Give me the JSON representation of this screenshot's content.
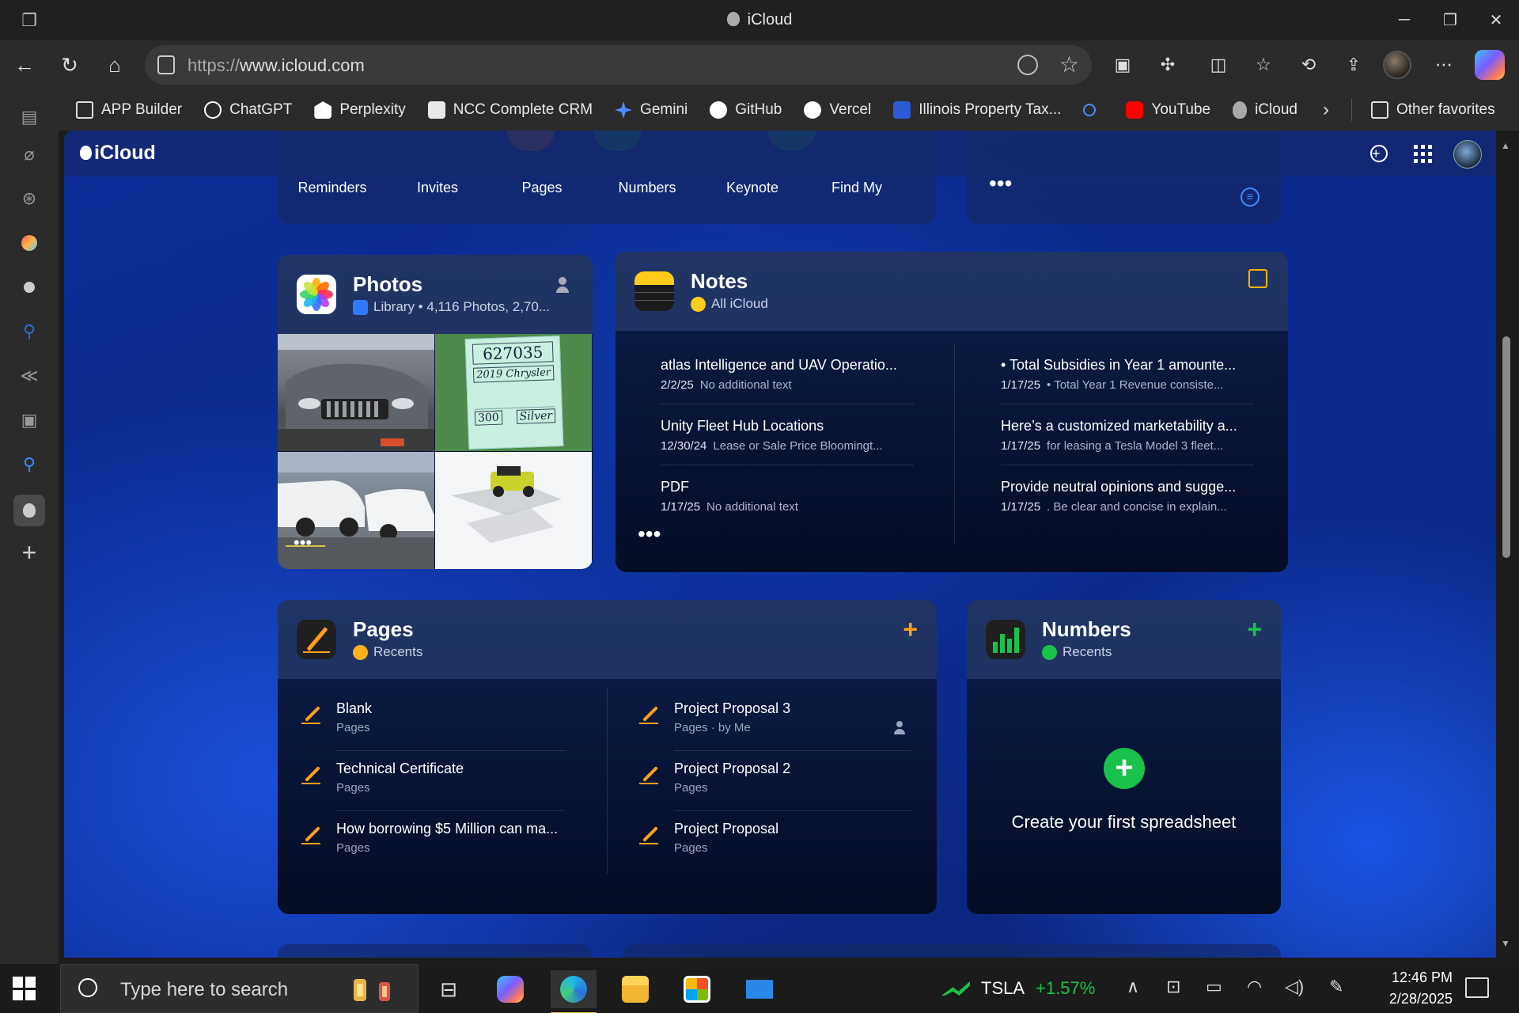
{
  "window": {
    "title": "iCloud"
  },
  "browser": {
    "url_prefix": "https://",
    "url_host": "www.icloud.com",
    "favorites": [
      {
        "label": "APP Builder",
        "icon": "folder-icon"
      },
      {
        "label": "ChatGPT",
        "icon": "chatgpt-icon"
      },
      {
        "label": "Perplexity",
        "icon": "perplexity-icon"
      },
      {
        "label": "NCC Complete CRM",
        "icon": "ncc-icon"
      },
      {
        "label": "Gemini",
        "icon": "gemini-icon"
      },
      {
        "label": "GitHub",
        "icon": "github-icon"
      },
      {
        "label": "Vercel",
        "icon": "vercel-icon"
      },
      {
        "label": "Illinois Property Tax...",
        "icon": "tax-icon"
      },
      {
        "label": "",
        "icon": "search-icon"
      },
      {
        "label": "YouTube",
        "icon": "youtube-icon"
      },
      {
        "label": "iCloud",
        "icon": "apple-icon"
      }
    ],
    "other_favorites": "Other favorites"
  },
  "icloud": {
    "logo": "iCloud",
    "apps": [
      "Reminders",
      "Invites",
      "Pages",
      "Numbers",
      "Keynote",
      "Find My"
    ],
    "photos": {
      "title": "Photos",
      "subtitle": "Library • 4,116 Photos, 2,70...",
      "tag_lines": [
        "627035",
        "2019 Chrysler",
        "300",
        "Silver"
      ]
    },
    "notes": {
      "title": "Notes",
      "subtitle": "All iCloud",
      "items": [
        {
          "title": "atlas Intelligence and UAV Operatio...",
          "date": "2/2/25",
          "preview": "No additional text"
        },
        {
          "title": "Unity Fleet Hub Locations",
          "date": "12/30/24",
          "preview": "Lease or Sale Price Bloomingt..."
        },
        {
          "title": "PDF",
          "date": "1/17/25",
          "preview": "No additional text"
        },
        {
          "title": "• Total Subsidies in Year 1 amounte...",
          "date": "1/17/25",
          "preview": "• Total Year 1 Revenue consiste..."
        },
        {
          "title": "Here’s a customized marketability a...",
          "date": "1/17/25",
          "preview": "for leasing a Tesla Model 3 fleet..."
        },
        {
          "title": "Provide neutral opinions and sugge...",
          "date": "1/17/25",
          "preview": ". Be clear and concise in explain..."
        }
      ]
    },
    "pages": {
      "title": "Pages",
      "subtitle": "Recents",
      "items": [
        {
          "title": "Blank",
          "sub": "Pages"
        },
        {
          "title": "Technical Certificate",
          "sub": "Pages"
        },
        {
          "title": "How borrowing $5 Million can ma...",
          "sub": "Pages"
        },
        {
          "title": "Project Proposal 3",
          "sub": "Pages · by Me"
        },
        {
          "title": "Project Proposal 2",
          "sub": "Pages"
        },
        {
          "title": "Project Proposal",
          "sub": "Pages"
        }
      ]
    },
    "numbers": {
      "title": "Numbers",
      "subtitle": "Recents",
      "empty_text": "Create your first spreadsheet"
    }
  },
  "taskbar": {
    "search_placeholder": "Type here to search",
    "stock_symbol": "TSLA",
    "stock_change": "+1.57%",
    "time": "12:46 PM",
    "date": "2/28/2025"
  },
  "colors": {
    "accent_orange": "#ff9e1b",
    "accent_green": "#19c24a",
    "notes_yellow": "#ffcc1a",
    "pages_blue_action": "#2f86ff"
  }
}
